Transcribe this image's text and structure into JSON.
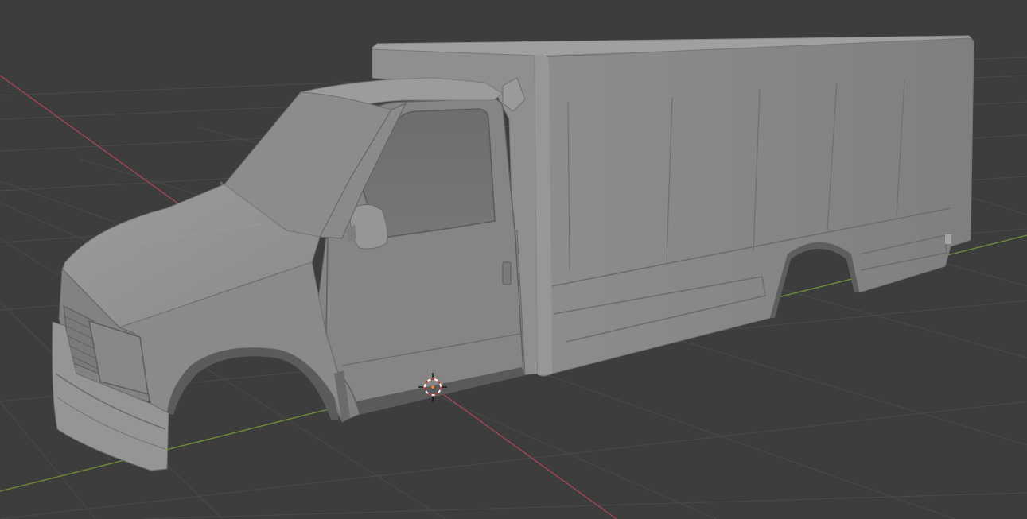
{
  "viewport": {
    "editor": "3D Viewport",
    "background_color": "#3d3d3d",
    "grid_color": "#4b4b4b",
    "x_axis_color": "#a84652",
    "y_axis_color": "#6e9234"
  },
  "scene": {
    "object": {
      "kind": "box truck body mesh",
      "shading": "solid",
      "base_color": "#8e8e8e"
    },
    "cursor": {
      "kind": "3d-cursor",
      "ring_colors": [
        "#c8372d",
        "#ffffff"
      ]
    }
  }
}
